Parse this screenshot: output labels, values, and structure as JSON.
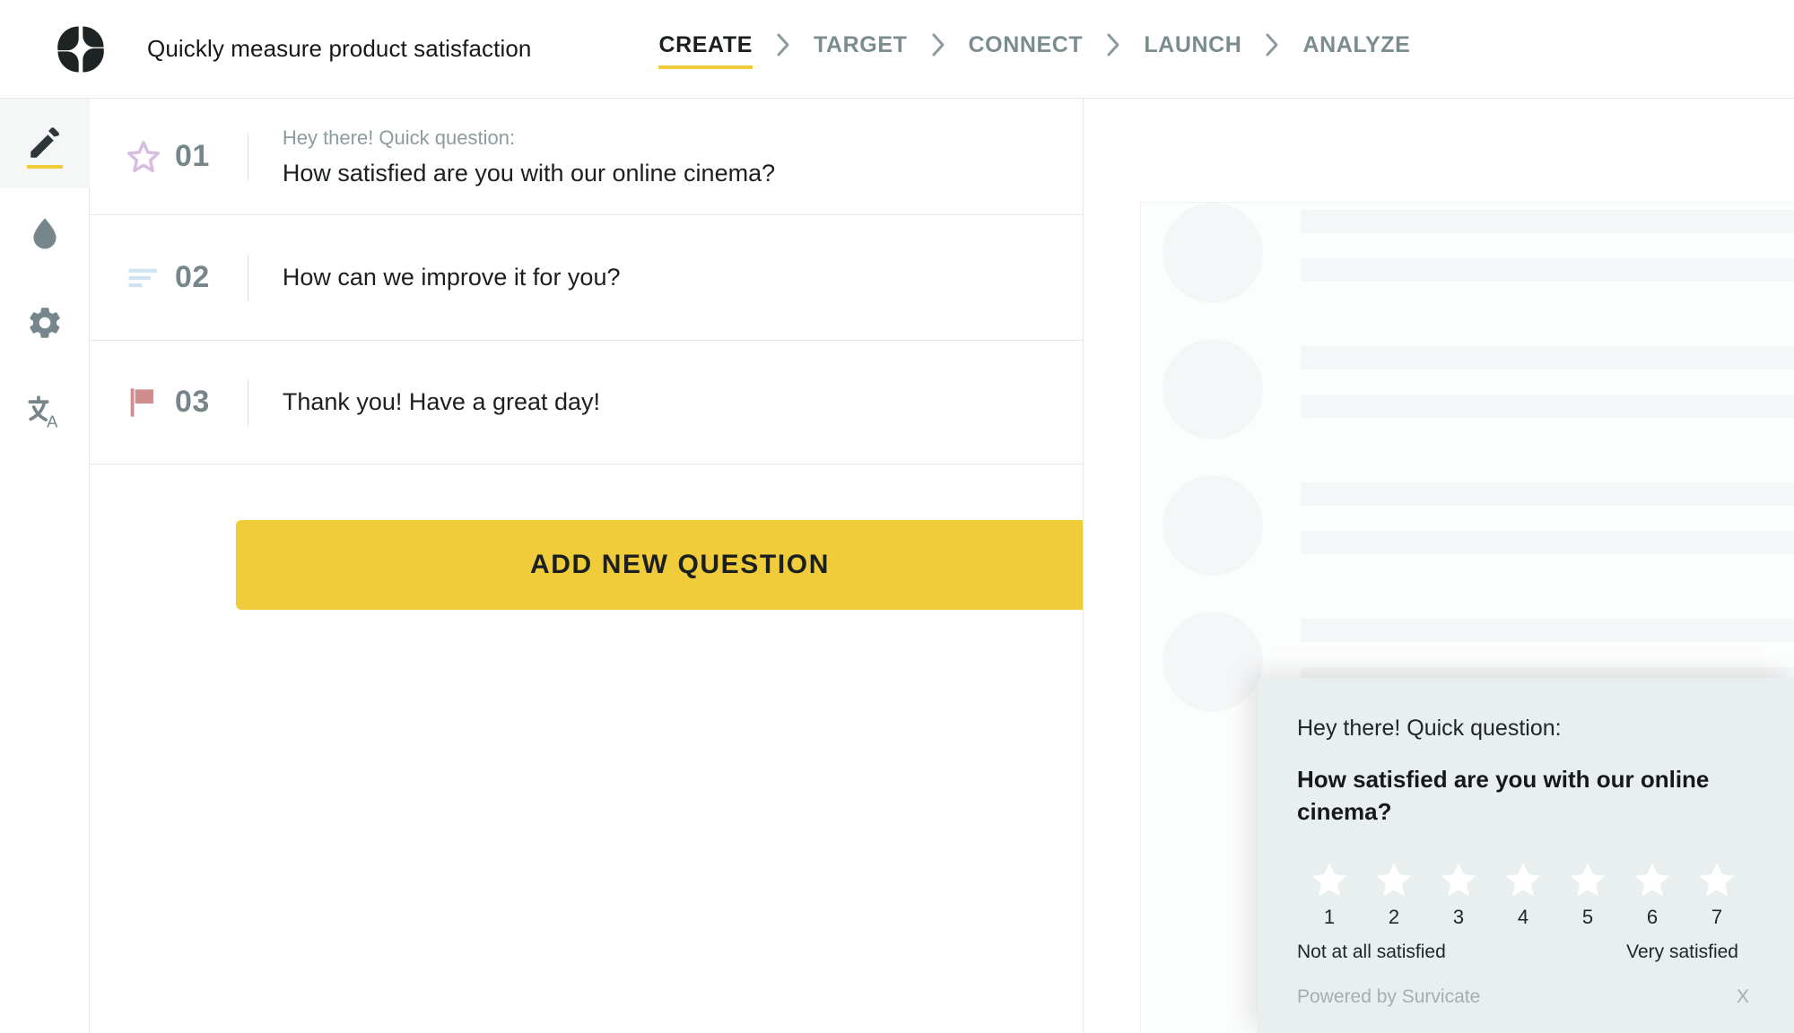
{
  "header": {
    "logo_name": "survicate-logo",
    "survey_title": "Quickly measure product satisfaction",
    "steps": [
      {
        "label": "CREATE",
        "active": true
      },
      {
        "label": "TARGET",
        "active": false
      },
      {
        "label": "CONNECT",
        "active": false
      },
      {
        "label": "LAUNCH",
        "active": false
      },
      {
        "label": "ANALYZE",
        "active": false
      }
    ]
  },
  "sidebar": {
    "items": [
      {
        "icon": "pencil-icon",
        "name": "sidebar-item-edit",
        "active": true
      },
      {
        "icon": "droplet-icon",
        "name": "sidebar-item-design",
        "active": false
      },
      {
        "icon": "gear-icon",
        "name": "sidebar-item-settings",
        "active": false
      },
      {
        "icon": "translate-icon",
        "name": "sidebar-item-translate",
        "active": false
      }
    ]
  },
  "editor": {
    "questions": [
      {
        "number": "01",
        "icon": "star-icon",
        "intro": "Hey there! Quick question:",
        "text": "How satisfied are you with our online cinema?"
      },
      {
        "number": "02",
        "icon": "text-lines-icon",
        "intro": "",
        "text": "How can we improve it for you?"
      },
      {
        "number": "03",
        "icon": "flag-icon",
        "intro": "",
        "text": "Thank you! Have a great day!"
      }
    ],
    "add_question_label": "ADD NEW QUESTION"
  },
  "widget": {
    "intro": "Hey there! Quick question:",
    "question": "How satisfied are you with our online cinema?",
    "scale": [
      "1",
      "2",
      "3",
      "4",
      "5",
      "6",
      "7"
    ],
    "low_label": "Not at all satisfied",
    "high_label": "Very satisfied",
    "powered_by": "Powered by Survicate",
    "close_label": "X"
  },
  "colors": {
    "accent_yellow": "#f0cc3a",
    "step_inactive": "#7b8c8f",
    "star_purple": "#d8bde2",
    "lines_blue": "#cfe4f2",
    "flag_rose": "#cf8d8d",
    "widget_bg": "#e9eeef",
    "border": "#e3e8ea"
  }
}
